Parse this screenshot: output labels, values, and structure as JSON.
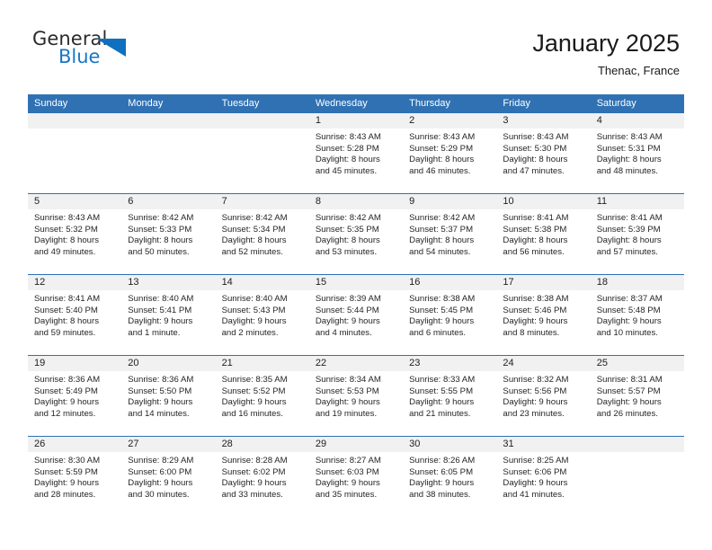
{
  "brand": {
    "name_part1": "General",
    "name_part2": "Blue"
  },
  "header": {
    "title": "January 2025",
    "location": "Thenac, France"
  },
  "colors": {
    "header_blue": "#3071b3",
    "logo_blue": "#1877c4",
    "day_band_gray": "#f1f1f1"
  },
  "weekdays": [
    "Sunday",
    "Monday",
    "Tuesday",
    "Wednesday",
    "Thursday",
    "Friday",
    "Saturday"
  ],
  "weeks": [
    [
      {
        "day": "",
        "sunrise": "",
        "sunset": "",
        "daylight_line1": "",
        "daylight_line2": ""
      },
      {
        "day": "",
        "sunrise": "",
        "sunset": "",
        "daylight_line1": "",
        "daylight_line2": ""
      },
      {
        "day": "",
        "sunrise": "",
        "sunset": "",
        "daylight_line1": "",
        "daylight_line2": ""
      },
      {
        "day": "1",
        "sunrise": "Sunrise: 8:43 AM",
        "sunset": "Sunset: 5:28 PM",
        "daylight_line1": "Daylight: 8 hours",
        "daylight_line2": "and 45 minutes."
      },
      {
        "day": "2",
        "sunrise": "Sunrise: 8:43 AM",
        "sunset": "Sunset: 5:29 PM",
        "daylight_line1": "Daylight: 8 hours",
        "daylight_line2": "and 46 minutes."
      },
      {
        "day": "3",
        "sunrise": "Sunrise: 8:43 AM",
        "sunset": "Sunset: 5:30 PM",
        "daylight_line1": "Daylight: 8 hours",
        "daylight_line2": "and 47 minutes."
      },
      {
        "day": "4",
        "sunrise": "Sunrise: 8:43 AM",
        "sunset": "Sunset: 5:31 PM",
        "daylight_line1": "Daylight: 8 hours",
        "daylight_line2": "and 48 minutes."
      }
    ],
    [
      {
        "day": "5",
        "sunrise": "Sunrise: 8:43 AM",
        "sunset": "Sunset: 5:32 PM",
        "daylight_line1": "Daylight: 8 hours",
        "daylight_line2": "and 49 minutes."
      },
      {
        "day": "6",
        "sunrise": "Sunrise: 8:42 AM",
        "sunset": "Sunset: 5:33 PM",
        "daylight_line1": "Daylight: 8 hours",
        "daylight_line2": "and 50 minutes."
      },
      {
        "day": "7",
        "sunrise": "Sunrise: 8:42 AM",
        "sunset": "Sunset: 5:34 PM",
        "daylight_line1": "Daylight: 8 hours",
        "daylight_line2": "and 52 minutes."
      },
      {
        "day": "8",
        "sunrise": "Sunrise: 8:42 AM",
        "sunset": "Sunset: 5:35 PM",
        "daylight_line1": "Daylight: 8 hours",
        "daylight_line2": "and 53 minutes."
      },
      {
        "day": "9",
        "sunrise": "Sunrise: 8:42 AM",
        "sunset": "Sunset: 5:37 PM",
        "daylight_line1": "Daylight: 8 hours",
        "daylight_line2": "and 54 minutes."
      },
      {
        "day": "10",
        "sunrise": "Sunrise: 8:41 AM",
        "sunset": "Sunset: 5:38 PM",
        "daylight_line1": "Daylight: 8 hours",
        "daylight_line2": "and 56 minutes."
      },
      {
        "day": "11",
        "sunrise": "Sunrise: 8:41 AM",
        "sunset": "Sunset: 5:39 PM",
        "daylight_line1": "Daylight: 8 hours",
        "daylight_line2": "and 57 minutes."
      }
    ],
    [
      {
        "day": "12",
        "sunrise": "Sunrise: 8:41 AM",
        "sunset": "Sunset: 5:40 PM",
        "daylight_line1": "Daylight: 8 hours",
        "daylight_line2": "and 59 minutes."
      },
      {
        "day": "13",
        "sunrise": "Sunrise: 8:40 AM",
        "sunset": "Sunset: 5:41 PM",
        "daylight_line1": "Daylight: 9 hours",
        "daylight_line2": "and 1 minute."
      },
      {
        "day": "14",
        "sunrise": "Sunrise: 8:40 AM",
        "sunset": "Sunset: 5:43 PM",
        "daylight_line1": "Daylight: 9 hours",
        "daylight_line2": "and 2 minutes."
      },
      {
        "day": "15",
        "sunrise": "Sunrise: 8:39 AM",
        "sunset": "Sunset: 5:44 PM",
        "daylight_line1": "Daylight: 9 hours",
        "daylight_line2": "and 4 minutes."
      },
      {
        "day": "16",
        "sunrise": "Sunrise: 8:38 AM",
        "sunset": "Sunset: 5:45 PM",
        "daylight_line1": "Daylight: 9 hours",
        "daylight_line2": "and 6 minutes."
      },
      {
        "day": "17",
        "sunrise": "Sunrise: 8:38 AM",
        "sunset": "Sunset: 5:46 PM",
        "daylight_line1": "Daylight: 9 hours",
        "daylight_line2": "and 8 minutes."
      },
      {
        "day": "18",
        "sunrise": "Sunrise: 8:37 AM",
        "sunset": "Sunset: 5:48 PM",
        "daylight_line1": "Daylight: 9 hours",
        "daylight_line2": "and 10 minutes."
      }
    ],
    [
      {
        "day": "19",
        "sunrise": "Sunrise: 8:36 AM",
        "sunset": "Sunset: 5:49 PM",
        "daylight_line1": "Daylight: 9 hours",
        "daylight_line2": "and 12 minutes."
      },
      {
        "day": "20",
        "sunrise": "Sunrise: 8:36 AM",
        "sunset": "Sunset: 5:50 PM",
        "daylight_line1": "Daylight: 9 hours",
        "daylight_line2": "and 14 minutes."
      },
      {
        "day": "21",
        "sunrise": "Sunrise: 8:35 AM",
        "sunset": "Sunset: 5:52 PM",
        "daylight_line1": "Daylight: 9 hours",
        "daylight_line2": "and 16 minutes."
      },
      {
        "day": "22",
        "sunrise": "Sunrise: 8:34 AM",
        "sunset": "Sunset: 5:53 PM",
        "daylight_line1": "Daylight: 9 hours",
        "daylight_line2": "and 19 minutes."
      },
      {
        "day": "23",
        "sunrise": "Sunrise: 8:33 AM",
        "sunset": "Sunset: 5:55 PM",
        "daylight_line1": "Daylight: 9 hours",
        "daylight_line2": "and 21 minutes."
      },
      {
        "day": "24",
        "sunrise": "Sunrise: 8:32 AM",
        "sunset": "Sunset: 5:56 PM",
        "daylight_line1": "Daylight: 9 hours",
        "daylight_line2": "and 23 minutes."
      },
      {
        "day": "25",
        "sunrise": "Sunrise: 8:31 AM",
        "sunset": "Sunset: 5:57 PM",
        "daylight_line1": "Daylight: 9 hours",
        "daylight_line2": "and 26 minutes."
      }
    ],
    [
      {
        "day": "26",
        "sunrise": "Sunrise: 8:30 AM",
        "sunset": "Sunset: 5:59 PM",
        "daylight_line1": "Daylight: 9 hours",
        "daylight_line2": "and 28 minutes."
      },
      {
        "day": "27",
        "sunrise": "Sunrise: 8:29 AM",
        "sunset": "Sunset: 6:00 PM",
        "daylight_line1": "Daylight: 9 hours",
        "daylight_line2": "and 30 minutes."
      },
      {
        "day": "28",
        "sunrise": "Sunrise: 8:28 AM",
        "sunset": "Sunset: 6:02 PM",
        "daylight_line1": "Daylight: 9 hours",
        "daylight_line2": "and 33 minutes."
      },
      {
        "day": "29",
        "sunrise": "Sunrise: 8:27 AM",
        "sunset": "Sunset: 6:03 PM",
        "daylight_line1": "Daylight: 9 hours",
        "daylight_line2": "and 35 minutes."
      },
      {
        "day": "30",
        "sunrise": "Sunrise: 8:26 AM",
        "sunset": "Sunset: 6:05 PM",
        "daylight_line1": "Daylight: 9 hours",
        "daylight_line2": "and 38 minutes."
      },
      {
        "day": "31",
        "sunrise": "Sunrise: 8:25 AM",
        "sunset": "Sunset: 6:06 PM",
        "daylight_line1": "Daylight: 9 hours",
        "daylight_line2": "and 41 minutes."
      },
      {
        "day": "",
        "sunrise": "",
        "sunset": "",
        "daylight_line1": "",
        "daylight_line2": ""
      }
    ]
  ]
}
